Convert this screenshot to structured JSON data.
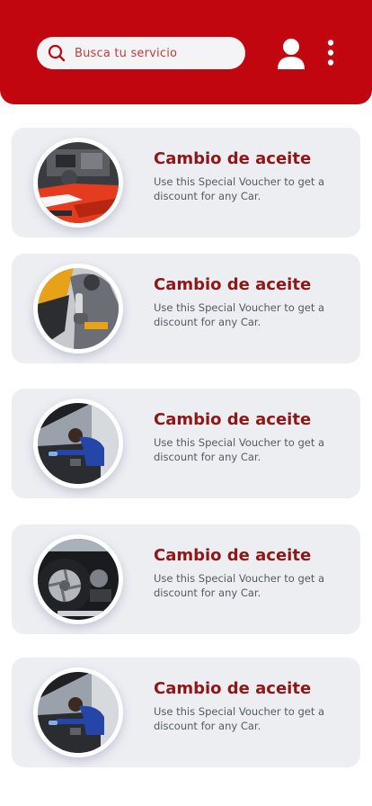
{
  "header": {
    "search_placeholder": "Busca tu servicio",
    "search_icon": "search-icon",
    "user_icon": "user-icon",
    "menu_icon": "kebab-menu-icon",
    "accent_color": "#c1060f"
  },
  "cards": [
    {
      "title": "Cambio de aceite",
      "description": "Use this Special Voucher to get a discount for any Car.",
      "image": "engine-bay-red-car-photo"
    },
    {
      "title": "Cambio de aceite",
      "description": "Use this Special Voucher to get a discount for any Car.",
      "image": "mechanic-with-wrench-photo"
    },
    {
      "title": "Cambio de aceite",
      "description": "Use this Special Voucher to get a discount for any Car.",
      "image": "mechanic-under-hood-photo"
    },
    {
      "title": "Cambio de aceite",
      "description": "Use this Special Voucher to get a discount for any Car.",
      "image": "tire-change-photo"
    },
    {
      "title": "Cambio de aceite",
      "description": "Use this Special Voucher to get a discount for any Car.",
      "image": "mechanic-under-hood-photo"
    }
  ]
}
